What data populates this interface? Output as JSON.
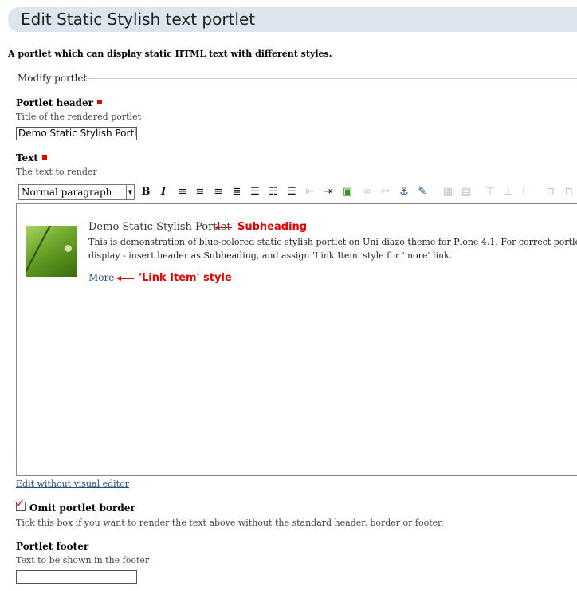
{
  "page": {
    "title": "Edit Static Stylish text portlet",
    "description": "A portlet which can display static HTML text with different styles.",
    "fieldset_legend": "Modify portlet"
  },
  "fields": {
    "header": {
      "label": "Portlet header",
      "help": "Title of the rendered portlet",
      "value": "Demo Static Stylish Portlet"
    },
    "text": {
      "label": "Text",
      "help": "The text to render"
    },
    "omit_border": {
      "label": "Omit portlet border",
      "help": "Tick this box if you want to render the text above without the standard header, border or footer.",
      "checked": true
    },
    "footer": {
      "label": "Portlet footer",
      "help": "Text to be shown in the footer",
      "value": ""
    }
  },
  "toolbar": {
    "format_value": "Normal paragraph",
    "buttons": [
      {
        "name": "bold-icon",
        "glyph": "B"
      },
      {
        "name": "italic-icon",
        "glyph": "I"
      },
      {
        "name": "align-left-icon",
        "glyph": "≡"
      },
      {
        "name": "align-center-icon",
        "glyph": "≡"
      },
      {
        "name": "align-right-icon",
        "glyph": "≡"
      },
      {
        "name": "align-justify-icon",
        "glyph": "≡"
      },
      {
        "name": "bullet-list-icon",
        "glyph": "☰"
      },
      {
        "name": "numbered-list-icon",
        "glyph": "☷"
      },
      {
        "name": "definition-list-icon",
        "glyph": "☰"
      },
      {
        "name": "outdent-icon",
        "glyph": "⇤"
      },
      {
        "name": "indent-icon",
        "glyph": "⇥"
      },
      {
        "name": "insert-image-icon",
        "glyph": "▣"
      },
      {
        "name": "insert-link-icon",
        "glyph": "∞"
      },
      {
        "name": "remove-link-icon",
        "glyph": "✂"
      },
      {
        "name": "anchor-icon",
        "glyph": "⚓"
      },
      {
        "name": "edit-html-icon",
        "glyph": "✎"
      },
      {
        "name": "insert-table-icon",
        "glyph": "▦"
      },
      {
        "name": "table-properties-icon",
        "glyph": "▤"
      },
      {
        "name": "row-before-icon",
        "glyph": "⊤"
      },
      {
        "name": "row-after-icon",
        "glyph": "⊥"
      },
      {
        "name": "delete-row-icon",
        "glyph": "⊢"
      },
      {
        "name": "column-icon",
        "glyph": "⊓"
      }
    ]
  },
  "editor": {
    "heading": "Demo Static Stylish Portlet",
    "body": "This is demonstration of blue-colored static stylish portlet on Uni diazo theme for Plone 4.1. For correct portlet display - insert header as Subheading, and assign 'Link Item' style for 'more' link.",
    "more_link": "More",
    "annotation_subheading": "Subheading",
    "annotation_link_item": "'Link Item' style"
  },
  "links": {
    "edit_without_editor": "Edit without visual editor"
  },
  "colors": {
    "title_bar_bg": "#dde5ef",
    "required_marker": "#e00000",
    "annotation": "#e00000",
    "link": "#2a4f7a"
  }
}
